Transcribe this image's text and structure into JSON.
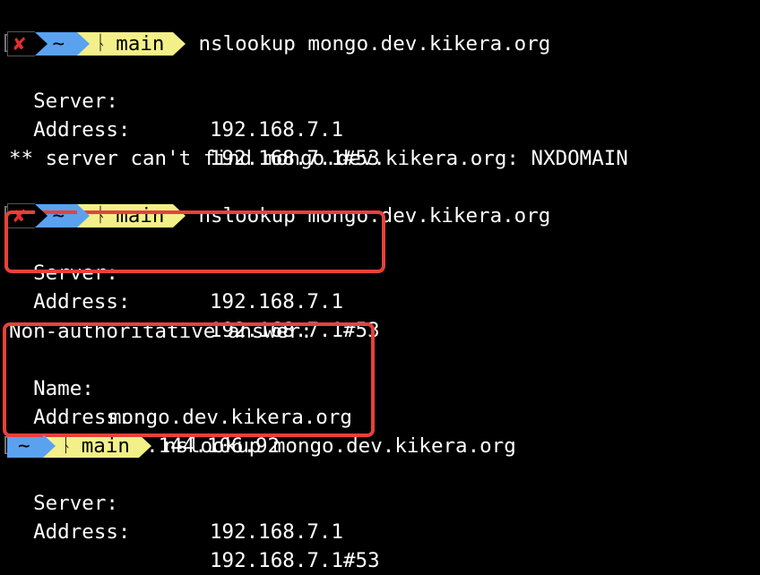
{
  "prompts": [
    {
      "status": "✘",
      "dir": "~",
      "branch_icon": "ᚿ",
      "branch": "main",
      "command": "nslookup mongo.dev.kikera.org"
    },
    {
      "status": "✘",
      "dir": "~",
      "branch_icon": "ᚿ",
      "branch": "main",
      "command": "nslookup mongo.dev.kikera.org"
    },
    {
      "dir": "~",
      "branch_icon": "ᚿ",
      "branch": "main",
      "command": "nslookup mongo.dev.kikera.org"
    }
  ],
  "block1": {
    "server_label": "Server:",
    "server_value": "192.168.7.1",
    "address_label": "Address:",
    "address_value": "192.168.7.1#53",
    "error": "** server can't find mongo.dev.kikera.org: NXDOMAIN"
  },
  "block2": {
    "server_label": "Server:",
    "server_value": "192.168.7.1",
    "address_label": "Address:",
    "address_value": "192.168.7.1#53",
    "answer_header": "Non-authoritative answer:",
    "name_label": "Name:",
    "name_value": "mongo.dev.kikera.org",
    "answer_address_label": "Address:",
    "answer_address_value": "10.144.106.92"
  },
  "block3": {
    "server_label": "Server:",
    "server_value": "192.168.7.1",
    "address_label": "Address:",
    "address_value": "192.168.7.1#53"
  },
  "colors": {
    "background": "#000000",
    "text": "#ffffff",
    "highlight": "#e8413a",
    "dir_segment": "#5aa2f0",
    "git_segment": "#f3f08a",
    "error_icon": "#e0312e"
  }
}
